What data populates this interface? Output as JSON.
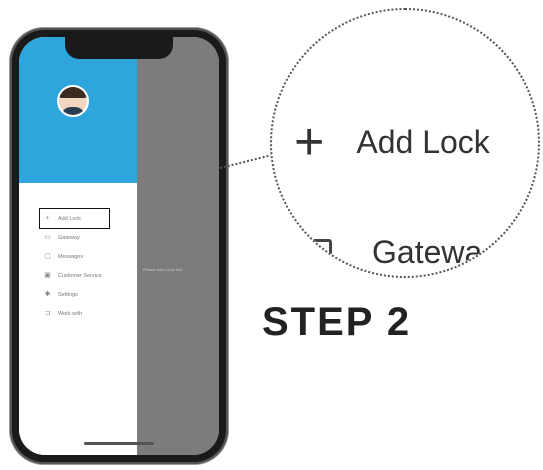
{
  "phone": {
    "status_time": "",
    "menu": {
      "items": [
        {
          "label": "Add Lock",
          "icon": "plus-icon"
        },
        {
          "label": "Gateway",
          "icon": "gateway-icon"
        },
        {
          "label": "Messages",
          "icon": "message-icon"
        },
        {
          "label": "Customer Service",
          "icon": "service-icon"
        },
        {
          "label": "Settings",
          "icon": "gear-icon"
        },
        {
          "label": "Work with",
          "icon": "link-icon"
        }
      ]
    },
    "overlay_text": "Please add a lock first"
  },
  "zoom": {
    "add_lock_label": "Add Lock",
    "gateway_label": "Gatewa"
  },
  "step_label": "STEP 2",
  "colors": {
    "drawer_header": "#2ea6dd",
    "overlay": "#7c7c7c",
    "highlight_box": "#111111"
  }
}
